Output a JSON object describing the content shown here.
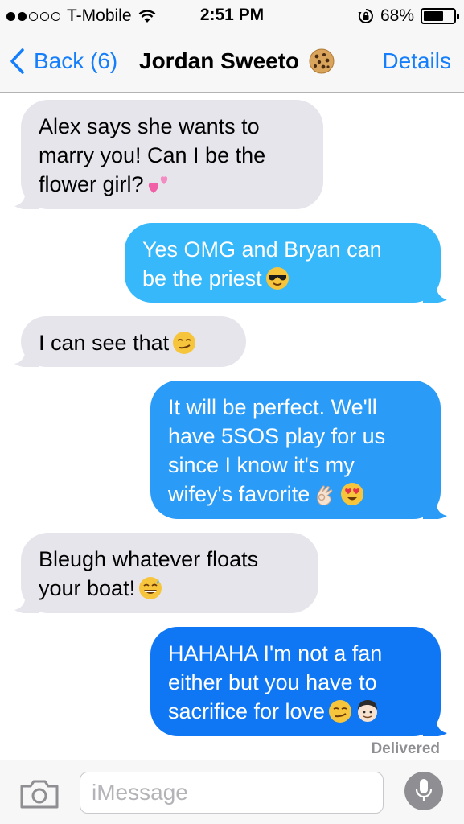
{
  "status_bar": {
    "signal_dots_filled": 2,
    "signal_dots_total": 5,
    "carrier": "T-Mobile",
    "time": "2:51 PM",
    "battery_percent_label": "68%",
    "battery_level": 0.68
  },
  "nav": {
    "back_label": "Back (6)",
    "title": "Jordan Sweeto",
    "title_icon": "cookie-icon",
    "details_label": "Details"
  },
  "colors": {
    "accent": "#147efb",
    "incoming_bubble": "#e6e5eb",
    "outgoing_light": "#35bafa",
    "outgoing_dark": "#0f77f4"
  },
  "messages": [
    {
      "direction": "incoming",
      "text": "Alex says she wants to\nmarry you! Can I be the\nflower girl?",
      "emoji": [
        "two-hearts-emoji"
      ]
    },
    {
      "direction": "outgoing",
      "text": "Yes OMG and Bryan can\nbe the priest",
      "emoji": [
        "sunglasses-emoji"
      ]
    },
    {
      "direction": "incoming",
      "text": "I can see that",
      "emoji": [
        "smirk-emoji"
      ]
    },
    {
      "direction": "outgoing",
      "text": "It will be perfect. We'll\nhave 5SOS play for us\nsince I know it's my\nwifey's favorite",
      "emoji": [
        "ok-hand-emoji",
        "heart-eyes-emoji"
      ]
    },
    {
      "direction": "incoming",
      "text": "Bleugh whatever floats\nyour boat!",
      "emoji": [
        "sweat-smile-emoji"
      ]
    },
    {
      "direction": "outgoing",
      "text": "HAHAHA I'm not a fan\neither but you have to\nsacrifice for love",
      "emoji": [
        "smirk-emoji",
        "man-face-emoji"
      ]
    }
  ],
  "delivered_label": "Delivered",
  "input": {
    "placeholder": "iMessage",
    "value": ""
  }
}
